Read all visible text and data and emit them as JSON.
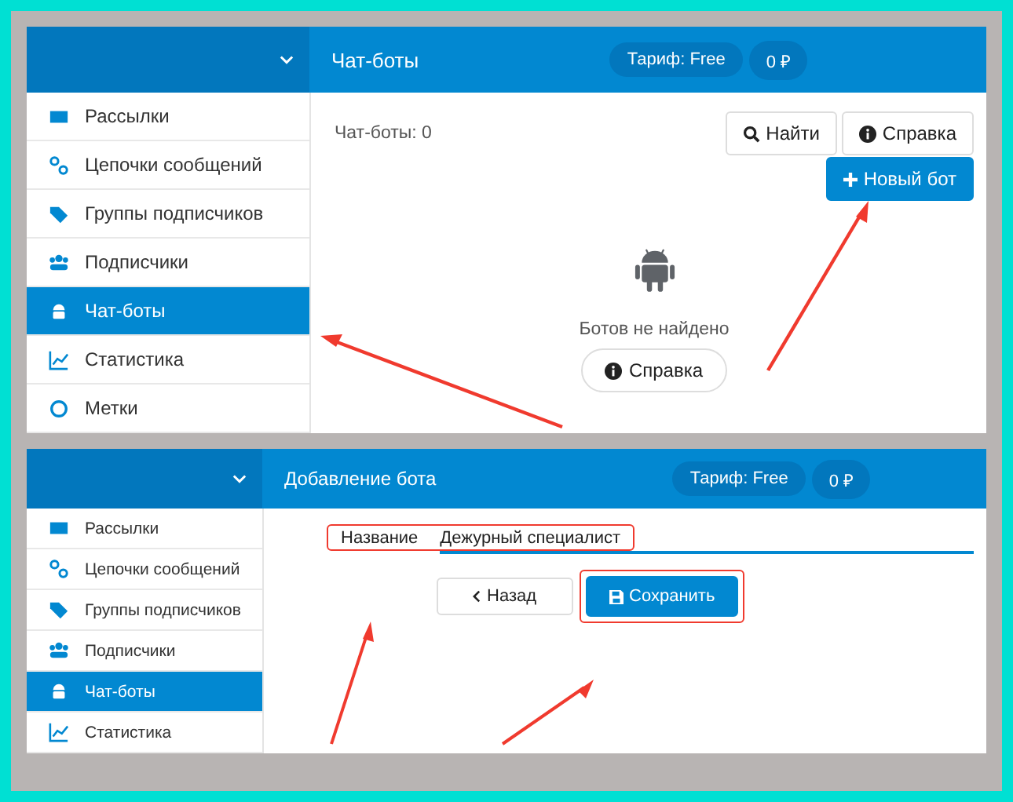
{
  "screens": [
    {
      "kind": "list",
      "header": {
        "title": "Чат-боты",
        "tariff": "Тариф: Free",
        "balance": "0 ₽"
      },
      "sidebar": {
        "items": [
          {
            "label": "Рассылки",
            "selected": false
          },
          {
            "label": "Цепочки сообщений",
            "selected": false
          },
          {
            "label": "Группы подписчиков",
            "selected": false
          },
          {
            "label": "Подписчики",
            "selected": false
          },
          {
            "label": "Чат-боты",
            "selected": true
          },
          {
            "label": "Статистика",
            "selected": false
          },
          {
            "label": "Метки",
            "selected": false
          }
        ]
      },
      "content": {
        "count": "Чат-боты: 0",
        "buttons": [
          {
            "label": "Найти"
          },
          {
            "label": "Справка"
          }
        ],
        "primary": {
          "label": "Новый бот"
        },
        "empty_text": "Ботов не найдено",
        "help_button": {
          "label": "Справка"
        }
      }
    },
    {
      "kind": "form",
      "header": {
        "title": "Добавление бота",
        "tariff": "Тариф: Free",
        "balance": "0 ₽"
      },
      "sidebar": {
        "items": [
          {
            "label": "Рассылки",
            "selected": false
          },
          {
            "label": "Цепочки сообщений",
            "selected": false
          },
          {
            "label": "Группы подписчиков",
            "selected": false
          },
          {
            "label": "Подписчики",
            "selected": false
          },
          {
            "label": "Чат-боты",
            "selected": true
          },
          {
            "label": "Статистика",
            "selected": false
          }
        ]
      },
      "form": {
        "field_label": "Название",
        "field_value": "Дежурный специалист",
        "back_button": "Назад",
        "save_button": "Сохранить"
      }
    }
  ]
}
